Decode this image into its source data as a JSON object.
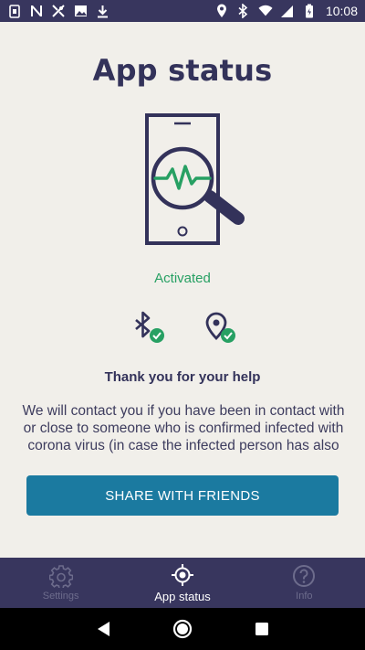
{
  "status_bar": {
    "time": "10:08",
    "left_icons": [
      "sim-icon",
      "n-icon",
      "cross-icon",
      "image-icon",
      "download-icon"
    ],
    "right_icons": [
      "location-icon",
      "bluetooth-icon",
      "wifi-icon",
      "signal-icon",
      "battery-icon"
    ]
  },
  "main": {
    "title": "App status",
    "hero_icon": "phone-magnifier-icon",
    "status": "Activated",
    "permissions": [
      "bluetooth-check-icon",
      "location-check-icon"
    ],
    "thanks": "Thank you for your help",
    "body": "We will contact you if you have been in contact with or close to someone who is confirmed infected with corona virus (in case the infected person has also",
    "share_button": "SHARE WITH FRIENDS"
  },
  "bottom_nav": {
    "items": [
      {
        "label": "Settings",
        "icon": "gear-icon",
        "active": false
      },
      {
        "label": "App status",
        "icon": "target-icon",
        "active": true
      },
      {
        "label": "Info",
        "icon": "question-icon",
        "active": false
      }
    ]
  },
  "colors": {
    "primary": "#38365e",
    "accent": "#1b7aa0",
    "success": "#27a063",
    "background": "#f1efea"
  }
}
